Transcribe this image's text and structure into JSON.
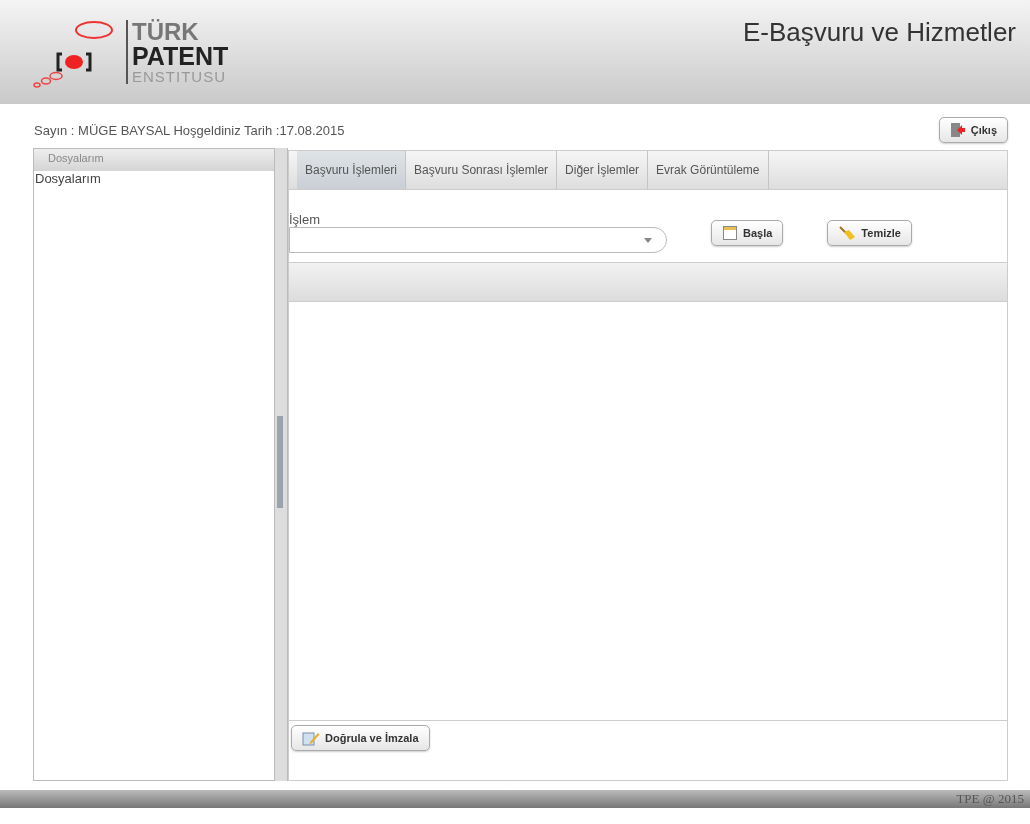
{
  "header": {
    "logo": {
      "line1": "TÜRK",
      "line2": "PATENT",
      "line3": "ENSTITUSU"
    },
    "title": "E-Başvuru ve Hizmetler"
  },
  "welcome": "Sayın : MÜGE BAYSAL Hoşgeldiniz Tarih :17.08.2015",
  "logout_button": "Çıkış",
  "sidebar": {
    "title": "Dosyalarım",
    "items": [
      {
        "label": "Dosyalarım",
        "selected": false
      }
    ]
  },
  "tabs": [
    {
      "label": "Başvuru İşlemleri",
      "selected": true
    },
    {
      "label": "Başvuru Sonrası İşlemler",
      "selected": false
    },
    {
      "label": "Diğer İşlemler",
      "selected": false
    },
    {
      "label": "Evrak Görüntüleme",
      "selected": false
    }
  ],
  "form": {
    "label": "İşlem",
    "start_button": "Başla",
    "clear_button": "Temizle"
  },
  "sign_button": "Doğrula ve İmzala",
  "footer": "TPE @ 2015"
}
